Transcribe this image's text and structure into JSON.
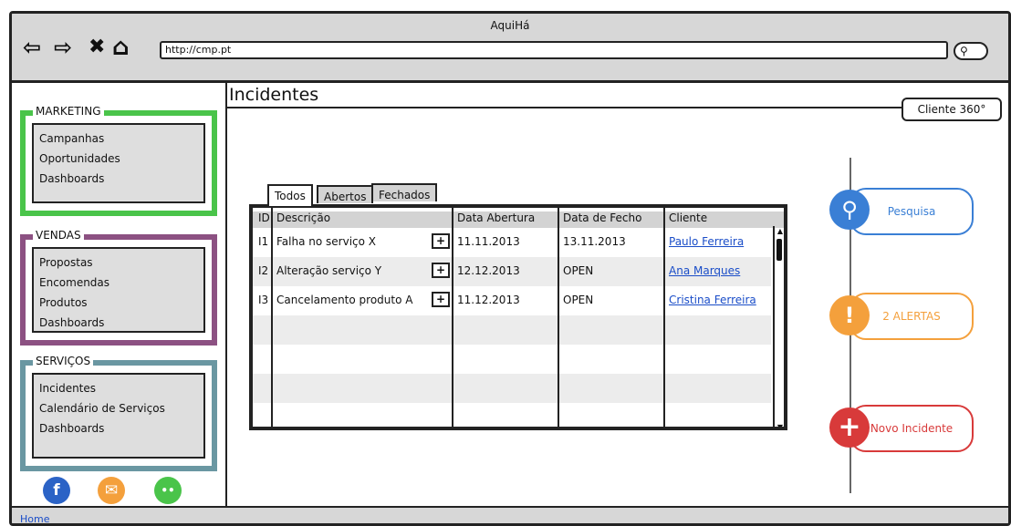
{
  "window": {
    "title": "AquiHá"
  },
  "browser": {
    "url": "http://cmp.pt",
    "back_icon": "arrow-left-icon",
    "forward_icon": "arrow-right-icon",
    "close_icon": "x-icon",
    "home_icon": "home-icon",
    "search_icon": "search-icon"
  },
  "sidebar": {
    "marketing": {
      "title": "MARKETING",
      "items": [
        "Campanhas",
        "Oportunidades",
        "Dashboards"
      ]
    },
    "vendas": {
      "title": "VENDAS",
      "items": [
        "Propostas",
        "Encomendas",
        "Produtos",
        "Dashboards"
      ]
    },
    "servicos": {
      "title": "SERVIÇOS",
      "items": [
        "Incidentes",
        "Calendário de Serviços",
        "Dashboards"
      ]
    },
    "social": [
      {
        "icon": "facebook-icon",
        "glyph": "f",
        "color": "#2b63c6"
      },
      {
        "icon": "email-icon",
        "glyph": "✉",
        "color": "#f4a03c"
      },
      {
        "icon": "chat-icon",
        "glyph": "••",
        "color": "#4ac44a"
      }
    ]
  },
  "main": {
    "title": "Incidentes",
    "cliente_360": "Cliente 360°",
    "tabs": [
      "Todos",
      "Abertos",
      "Fechados"
    ],
    "columns": [
      "ID",
      "Descrição",
      "Data Abertura",
      "Data de Fecho",
      "Cliente"
    ],
    "rows": [
      {
        "id": "I1",
        "descricao": "Falha no serviço X",
        "abertura": "11.11.2013",
        "fecho": "13.11.2013",
        "cliente": "Paulo Ferreira"
      },
      {
        "id": "I2",
        "descricao": "Alteração serviço Y",
        "abertura": "12.12.2013",
        "fecho": "OPEN",
        "cliente": "Ana Marques"
      },
      {
        "id": "I3",
        "descricao": "Cancelamento produto A",
        "abertura": "11.12.2013",
        "fecho": "OPEN",
        "cliente": "Cristina Ferreira"
      }
    ],
    "plus_label": "+"
  },
  "actions": {
    "pesquisa": {
      "label": "Pesquisa",
      "icon": "search-icon",
      "color": "#3a7fd5"
    },
    "alertas": {
      "label": "2 ALERTAS",
      "icon": "alert-icon",
      "color": "#f4a03c"
    },
    "novo": {
      "label": "Novo Incidente",
      "icon": "plus-icon",
      "color": "#d83a3a"
    }
  },
  "statusbar": {
    "home": "Home"
  }
}
